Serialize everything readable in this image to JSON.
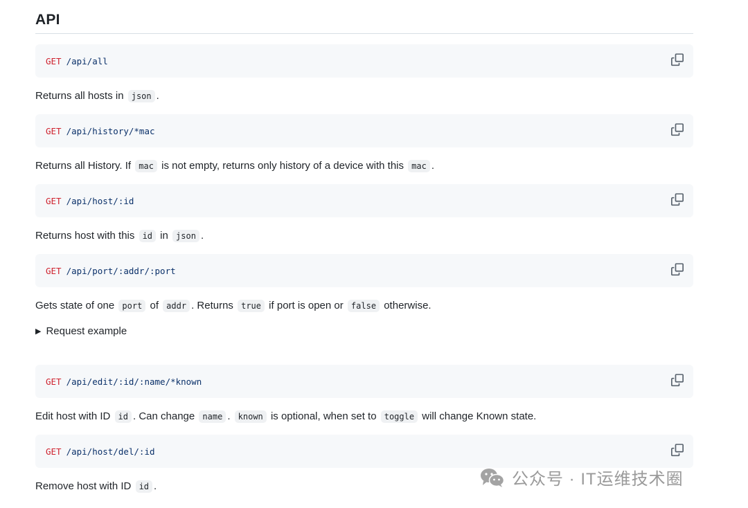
{
  "heading": "API",
  "endpoints": [
    {
      "method": "GET",
      "path": "/api/all"
    },
    {
      "method": "GET",
      "path": "/api/history/*mac"
    },
    {
      "method": "GET",
      "path": "/api/host/:id"
    },
    {
      "method": "GET",
      "path": "/api/port/:addr/:port"
    },
    {
      "method": "GET",
      "path": "/api/edit/:id/:name/*known"
    },
    {
      "method": "GET",
      "path": "/api/host/del/:id"
    }
  ],
  "descriptions": {
    "all": {
      "t1": "Returns all hosts in ",
      "c1": "json",
      "t2": "."
    },
    "history": {
      "t1": "Returns all History. If ",
      "c1": "mac",
      "t2": " is not empty, returns only history of a device with this ",
      "c2": "mac",
      "t3": "."
    },
    "host": {
      "t1": "Returns host with this ",
      "c1": "id",
      "t2": " in ",
      "c2": "json",
      "t3": "."
    },
    "port": {
      "t1": "Gets state of one ",
      "c1": "port",
      "t2": " of ",
      "c2": "addr",
      "t3": ". Returns ",
      "c3": "true",
      "t4": " if port is open or ",
      "c4": "false",
      "t5": " otherwise."
    },
    "edit": {
      "t1": "Edit host with ID ",
      "c1": "id",
      "t2": ". Can change ",
      "c2": "name",
      "t3": ". ",
      "c3": "known",
      "t4": " is optional, when set to ",
      "c4": "toggle",
      "t5": " will change Known state."
    },
    "del": {
      "t1": "Remove host with ID ",
      "c1": "id",
      "t2": "."
    }
  },
  "request_example": "Request example",
  "watermark": "公众号 · IT运维技术圈"
}
